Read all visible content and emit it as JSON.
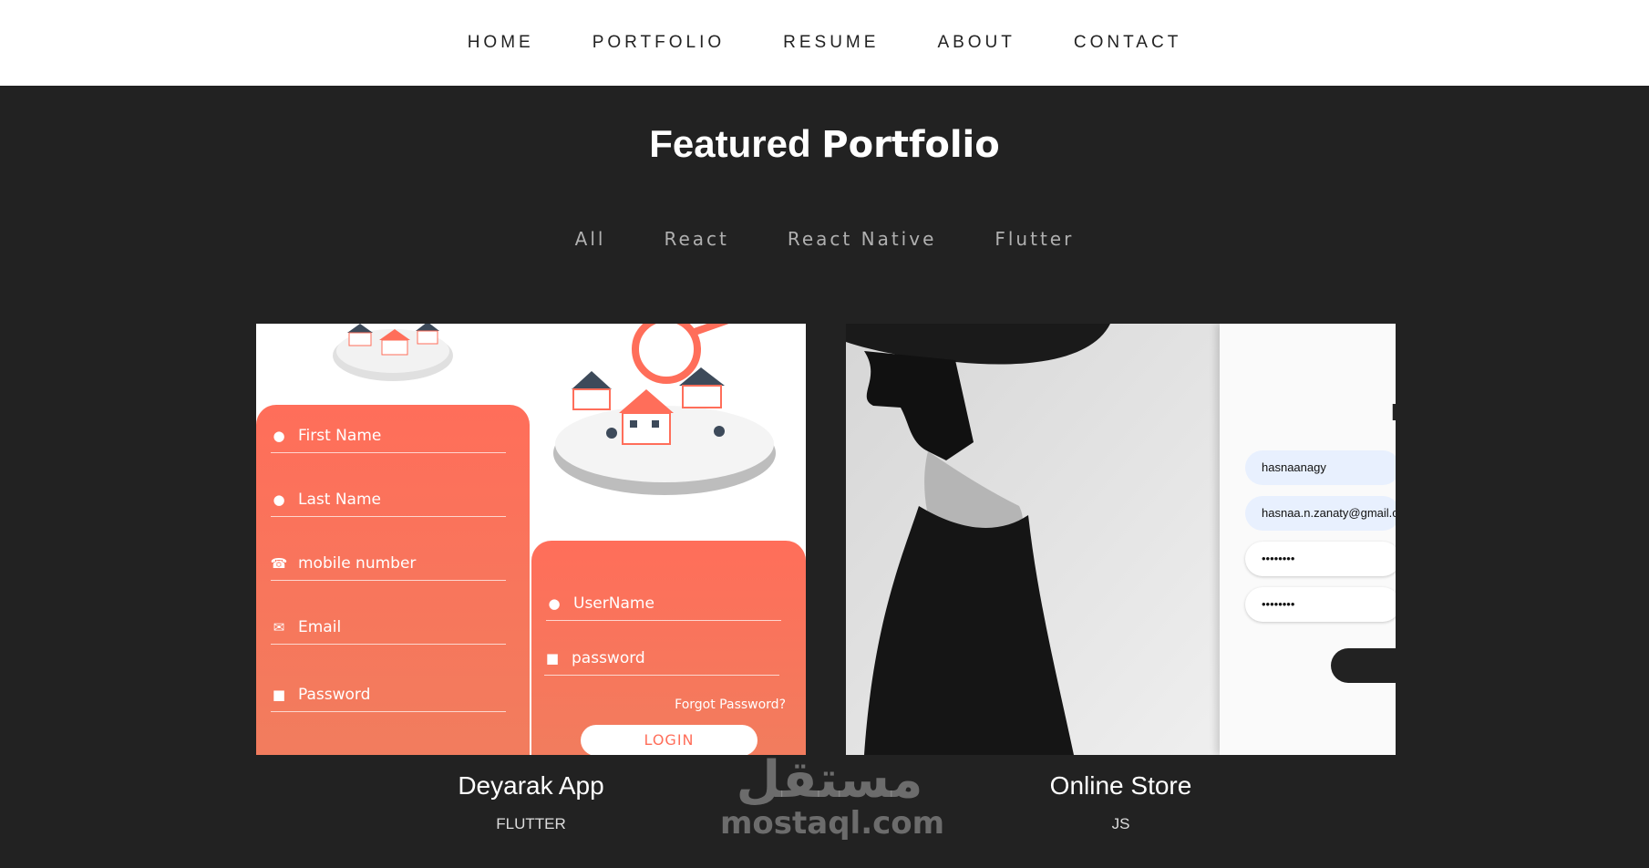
{
  "nav": {
    "items": [
      "HOME",
      "PORTFOLIO",
      "RESUME",
      "ABOUT",
      "CONTACT"
    ]
  },
  "portfolio": {
    "title_light": "Featured",
    "title_bold": "Portfolio",
    "filters": [
      "All",
      "React",
      "React Native",
      "Flutter"
    ]
  },
  "cards": [
    {
      "title": "Deyarak App",
      "category": "FLUTTER",
      "signup_fields": [
        "First Name",
        "Last Name",
        "mobile number",
        "Email",
        "Password"
      ],
      "login_fields": [
        "UserName",
        "password"
      ],
      "forgot": "Forgot Password?",
      "login_button": "LOGIN"
    },
    {
      "title": "Online Store",
      "category": "JS",
      "heading_fragment": "L",
      "inputs": [
        "hasnaanagy",
        "hasnaa.n.zanaty@gmail.c",
        "••••••••",
        "••••••••"
      ]
    }
  ],
  "watermark": {
    "arabic": "مستقل",
    "latin": "mostaql.com"
  },
  "colors": {
    "accent": "#ff6e5a",
    "background": "#222222",
    "navbar": "#ffffff"
  }
}
